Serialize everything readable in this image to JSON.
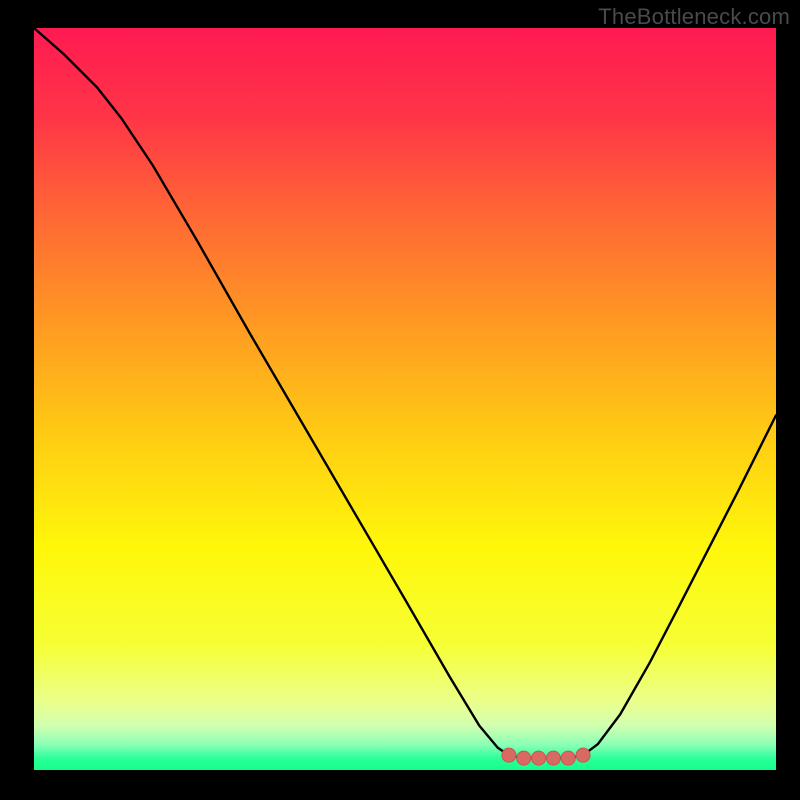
{
  "watermark": "TheBottleneck.com",
  "colors": {
    "page_bg": "#000000",
    "watermark": "#4a4a4a",
    "curve": "#000000",
    "marker_fill": "#d86a63",
    "marker_stroke": "#c8564f",
    "gradient_stops": [
      {
        "offset": 0.0,
        "color": "#ff1a52"
      },
      {
        "offset": 0.12,
        "color": "#ff3547"
      },
      {
        "offset": 0.26,
        "color": "#ff6a34"
      },
      {
        "offset": 0.4,
        "color": "#ff9a22"
      },
      {
        "offset": 0.54,
        "color": "#ffc914"
      },
      {
        "offset": 0.7,
        "color": "#fff70a"
      },
      {
        "offset": 0.83,
        "color": "#f6ff34"
      },
      {
        "offset": 0.905,
        "color": "#ecff88"
      },
      {
        "offset": 0.94,
        "color": "#d2ffb0"
      },
      {
        "offset": 0.966,
        "color": "#8affb6"
      },
      {
        "offset": 0.984,
        "color": "#2bff9a"
      },
      {
        "offset": 1.0,
        "color": "#13ff88"
      }
    ]
  },
  "chart_data": {
    "type": "line",
    "title": "",
    "xlabel": "",
    "ylabel": "",
    "xlim": [
      0,
      1
    ],
    "ylim": [
      0,
      1
    ],
    "curve": [
      {
        "x": 0.0,
        "y": 1.0
      },
      {
        "x": 0.04,
        "y": 0.965
      },
      {
        "x": 0.085,
        "y": 0.92
      },
      {
        "x": 0.118,
        "y": 0.878
      },
      {
        "x": 0.16,
        "y": 0.815
      },
      {
        "x": 0.22,
        "y": 0.713
      },
      {
        "x": 0.29,
        "y": 0.59
      },
      {
        "x": 0.36,
        "y": 0.47
      },
      {
        "x": 0.43,
        "y": 0.35
      },
      {
        "x": 0.5,
        "y": 0.23
      },
      {
        "x": 0.56,
        "y": 0.126
      },
      {
        "x": 0.6,
        "y": 0.06
      },
      {
        "x": 0.625,
        "y": 0.03
      },
      {
        "x": 0.64,
        "y": 0.02
      },
      {
        "x": 0.66,
        "y": 0.016
      },
      {
        "x": 0.68,
        "y": 0.016
      },
      {
        "x": 0.7,
        "y": 0.016
      },
      {
        "x": 0.72,
        "y": 0.016
      },
      {
        "x": 0.74,
        "y": 0.02
      },
      {
        "x": 0.76,
        "y": 0.035
      },
      {
        "x": 0.79,
        "y": 0.075
      },
      {
        "x": 0.83,
        "y": 0.145
      },
      {
        "x": 0.87,
        "y": 0.222
      },
      {
        "x": 0.91,
        "y": 0.3
      },
      {
        "x": 0.95,
        "y": 0.378
      },
      {
        "x": 1.0,
        "y": 0.478
      }
    ],
    "markers": [
      {
        "x": 0.64,
        "y": 0.02
      },
      {
        "x": 0.66,
        "y": 0.016
      },
      {
        "x": 0.68,
        "y": 0.016
      },
      {
        "x": 0.7,
        "y": 0.016
      },
      {
        "x": 0.72,
        "y": 0.016
      },
      {
        "x": 0.74,
        "y": 0.02
      }
    ],
    "marker_radius_px": 7
  }
}
